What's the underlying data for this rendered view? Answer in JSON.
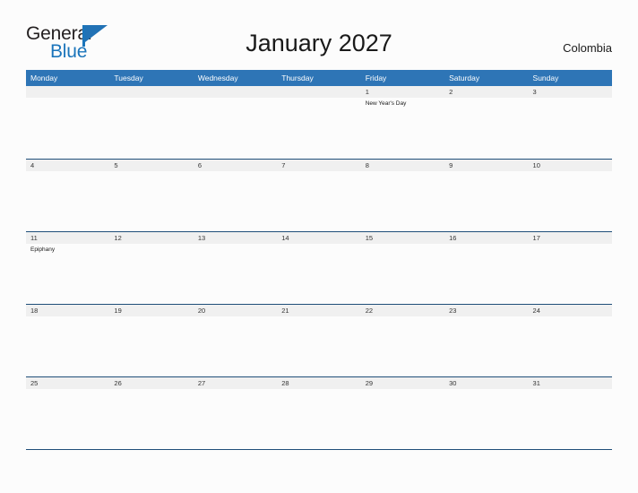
{
  "brand": {
    "name_top": "General",
    "name_bottom": "Blue",
    "flag_icon": "blue-flag-triangle",
    "color_primary": "#1b75bb",
    "color_dark": "#231f20"
  },
  "header": {
    "title": "January 2027",
    "country": "Colombia"
  },
  "calendar": {
    "header_bg": "#2e75b6",
    "date_band_bg": "#f0f0f0",
    "rule_color": "#1f4e79",
    "weekdays": [
      "Monday",
      "Tuesday",
      "Wednesday",
      "Thursday",
      "Friday",
      "Saturday",
      "Sunday"
    ],
    "weeks": [
      {
        "days": [
          {
            "num": "",
            "events": []
          },
          {
            "num": "",
            "events": []
          },
          {
            "num": "",
            "events": []
          },
          {
            "num": "",
            "events": []
          },
          {
            "num": "1",
            "events": [
              "New Year's Day"
            ]
          },
          {
            "num": "2",
            "events": []
          },
          {
            "num": "3",
            "events": []
          }
        ]
      },
      {
        "days": [
          {
            "num": "4",
            "events": []
          },
          {
            "num": "5",
            "events": []
          },
          {
            "num": "6",
            "events": []
          },
          {
            "num": "7",
            "events": []
          },
          {
            "num": "8",
            "events": []
          },
          {
            "num": "9",
            "events": []
          },
          {
            "num": "10",
            "events": []
          }
        ]
      },
      {
        "days": [
          {
            "num": "11",
            "events": [
              "Epiphany"
            ]
          },
          {
            "num": "12",
            "events": []
          },
          {
            "num": "13",
            "events": []
          },
          {
            "num": "14",
            "events": []
          },
          {
            "num": "15",
            "events": []
          },
          {
            "num": "16",
            "events": []
          },
          {
            "num": "17",
            "events": []
          }
        ]
      },
      {
        "days": [
          {
            "num": "18",
            "events": []
          },
          {
            "num": "19",
            "events": []
          },
          {
            "num": "20",
            "events": []
          },
          {
            "num": "21",
            "events": []
          },
          {
            "num": "22",
            "events": []
          },
          {
            "num": "23",
            "events": []
          },
          {
            "num": "24",
            "events": []
          }
        ]
      },
      {
        "days": [
          {
            "num": "25",
            "events": []
          },
          {
            "num": "26",
            "events": []
          },
          {
            "num": "27",
            "events": []
          },
          {
            "num": "28",
            "events": []
          },
          {
            "num": "29",
            "events": []
          },
          {
            "num": "30",
            "events": []
          },
          {
            "num": "31",
            "events": []
          }
        ]
      }
    ]
  }
}
